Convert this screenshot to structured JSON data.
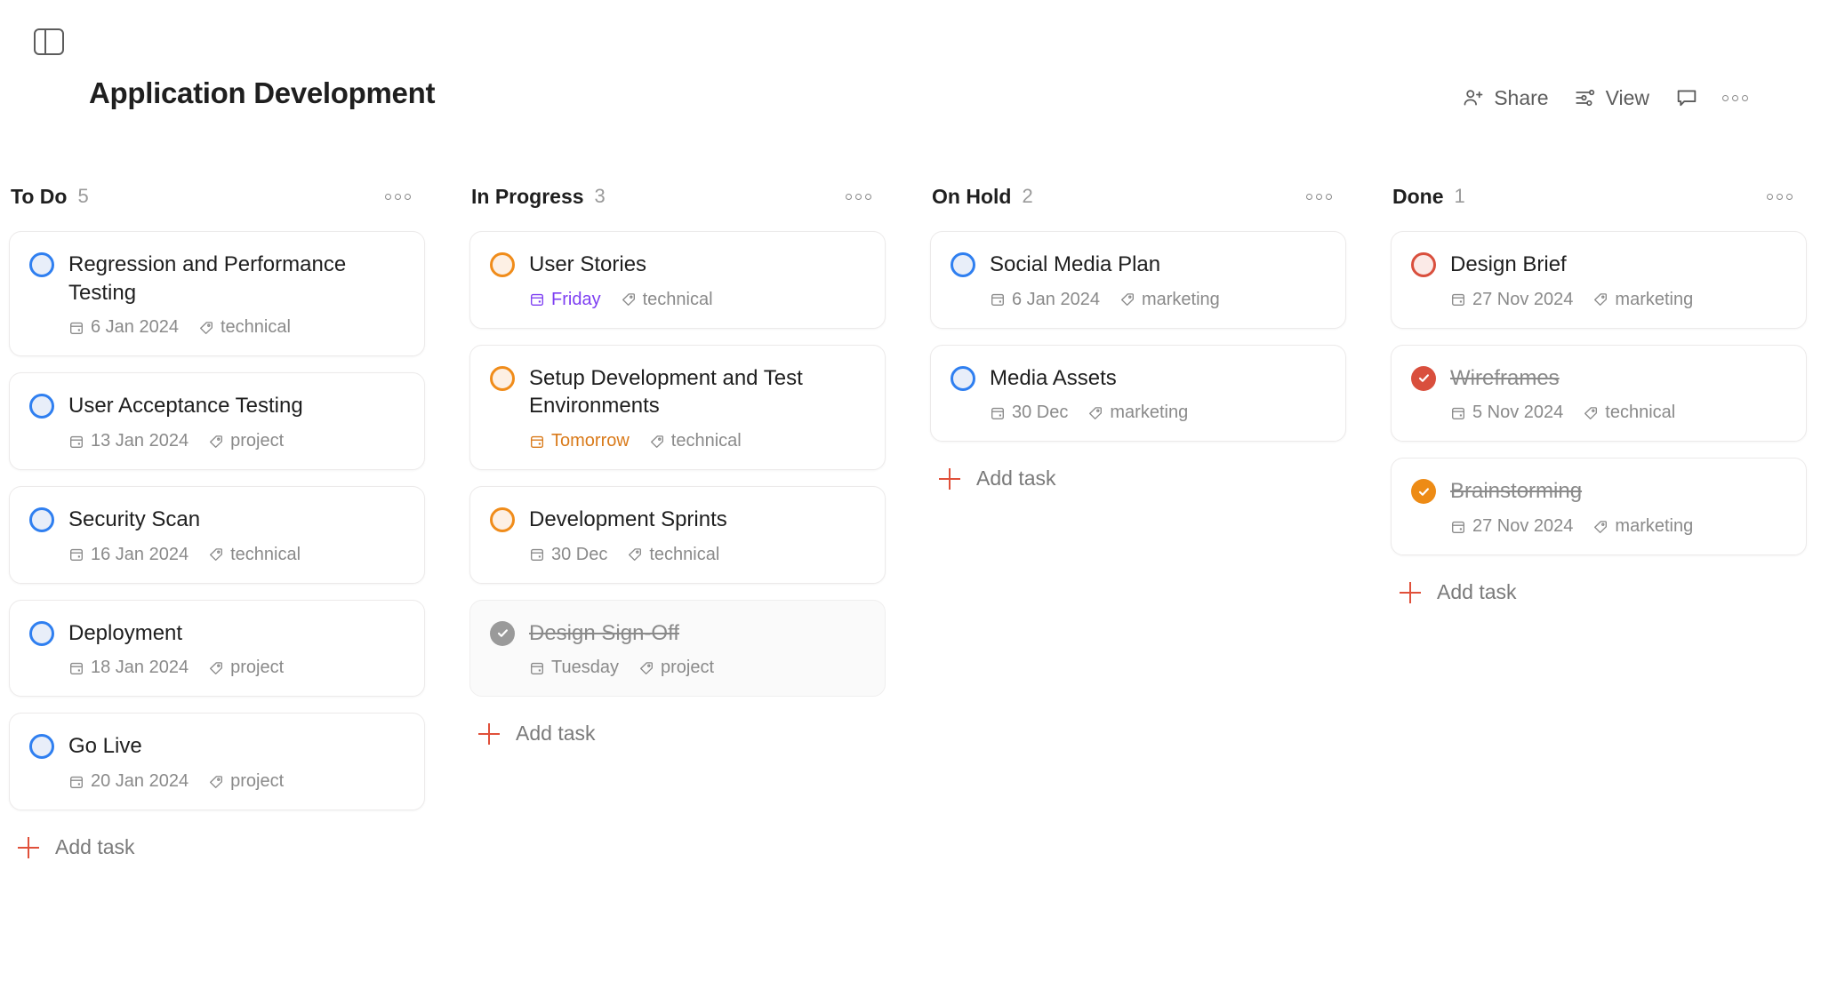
{
  "header": {
    "title": "Application Development",
    "sidebar_toggle_icon": "sidebar-toggle-icon",
    "actions": [
      {
        "label": "Share",
        "icon": "person-add-icon"
      },
      {
        "label": "View",
        "icon": "sliders-icon"
      },
      {
        "label": "",
        "icon": "comment-icon"
      },
      {
        "label": "",
        "icon": "more-horizontal-icon"
      }
    ]
  },
  "board": {
    "add_task_label": "Add task",
    "columns": [
      {
        "name": "To Do",
        "count": "5",
        "tasks": [
          {
            "title": "Regression and Performance Testing",
            "state": "open",
            "marker": "blue",
            "date": "6 Jan 2024",
            "date_style": "normal",
            "tag": "technical"
          },
          {
            "title": "User Acceptance Testing",
            "state": "open",
            "marker": "blue",
            "date": "13 Jan 2024",
            "date_style": "normal",
            "tag": "project"
          },
          {
            "title": "Security Scan",
            "state": "open",
            "marker": "blue",
            "date": "16 Jan 2024",
            "date_style": "normal",
            "tag": "technical"
          },
          {
            "title": "Deployment",
            "state": "open",
            "marker": "blue",
            "date": "18 Jan 2024",
            "date_style": "normal",
            "tag": "project"
          },
          {
            "title": "Go Live",
            "state": "open",
            "marker": "blue",
            "date": "20 Jan 2024",
            "date_style": "normal",
            "tag": "project"
          }
        ]
      },
      {
        "name": "In Progress",
        "count": "3",
        "tasks": [
          {
            "title": "User Stories",
            "state": "open",
            "marker": "orange",
            "date": "Friday",
            "date_style": "purple",
            "tag": "technical"
          },
          {
            "title": "Setup Development and Test Environments",
            "state": "open",
            "marker": "orange",
            "date": "Tomorrow",
            "date_style": "orange",
            "tag": "technical"
          },
          {
            "title": "Development Sprints",
            "state": "open",
            "marker": "orange",
            "date": "30 Dec",
            "date_style": "normal",
            "tag": "technical"
          },
          {
            "title": "Design Sign-Off",
            "state": "completed",
            "marker": "done-gray",
            "date": "Tuesday",
            "date_style": "normal",
            "tag": "project"
          }
        ]
      },
      {
        "name": "On Hold",
        "count": "2",
        "tasks": [
          {
            "title": "Social Media Plan",
            "state": "open",
            "marker": "blue",
            "date": "6 Jan 2024",
            "date_style": "normal",
            "tag": "marketing"
          },
          {
            "title": "Media Assets",
            "state": "open",
            "marker": "blue",
            "date": "30 Dec",
            "date_style": "normal",
            "tag": "marketing"
          }
        ]
      },
      {
        "name": "Done",
        "count": "1",
        "tasks": [
          {
            "title": "Design Brief",
            "state": "open",
            "marker": "red",
            "date": "27 Nov 2024",
            "date_style": "normal",
            "tag": "marketing"
          },
          {
            "title": "Wireframes",
            "state": "completed",
            "marker": "done-red",
            "date": "5 Nov 2024",
            "date_style": "normal",
            "tag": "technical"
          },
          {
            "title": "Brainstorming",
            "state": "completed",
            "marker": "done-orange",
            "date": "27 Nov 2024",
            "date_style": "normal",
            "tag": "marketing"
          }
        ]
      }
    ]
  },
  "colors": {
    "accent_red": "#e0503a",
    "marker_blue": "#2f7ff0",
    "marker_orange": "#f08c1a",
    "marker_red": "#d94f3d",
    "date_purple": "#7e3ff2",
    "date_orange": "#d97a1a"
  }
}
